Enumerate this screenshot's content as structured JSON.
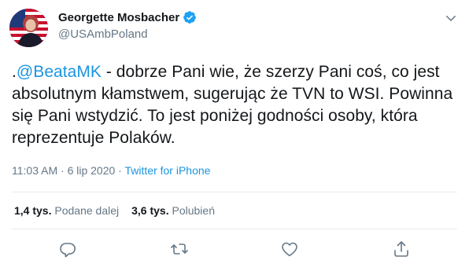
{
  "author": {
    "name": "Georgette Mosbacher",
    "handle": "@USAmbPoland"
  },
  "tweet": {
    "prefix": ".",
    "mention": "@BeataMK",
    "text": " - dobrze Pani wie, że szerzy Pani coś, co jest absolutnym kłamstwem, sugerując że TVN to WSI. Powinna się Pani wstydzić. To jest poniżej godności osoby, która reprezentuje Polaków."
  },
  "meta": {
    "time": "11:03 AM",
    "separator": " · ",
    "date": "6 lip 2020",
    "source": "Twitter for iPhone"
  },
  "stats": {
    "retweets_count": "1,4 tys.",
    "retweets_label": "Podane dalej",
    "likes_count": "3,6 tys.",
    "likes_label": "Polubień"
  },
  "icons": {
    "verified": "verified-badge-icon",
    "more": "chevron-down-icon",
    "reply": "reply-icon",
    "retweet": "retweet-icon",
    "like": "heart-icon",
    "share": "share-icon"
  },
  "colors": {
    "link": "#1b95e0",
    "secondary": "#657786",
    "primary_text": "#14171a"
  }
}
